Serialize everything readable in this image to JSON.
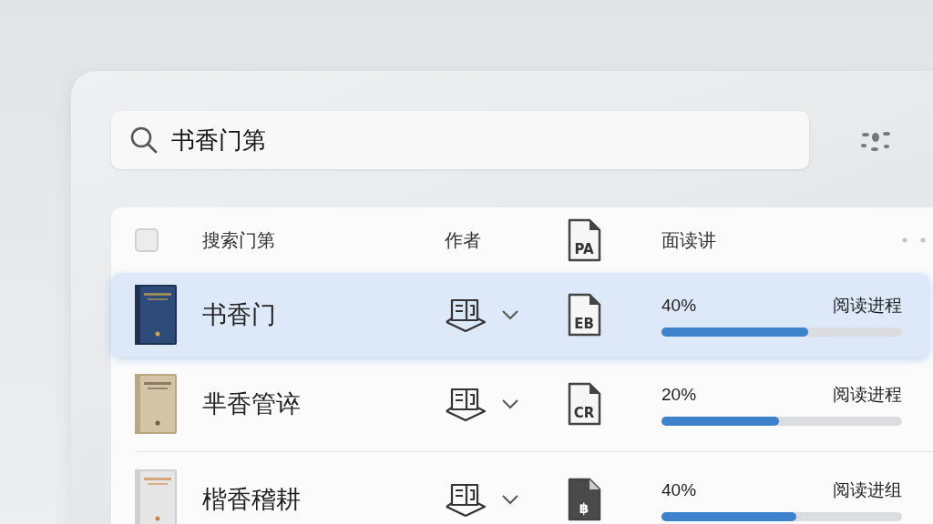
{
  "search": {
    "value": "书香门第"
  },
  "table": {
    "header": {
      "checked": false,
      "columns": [
        "搜索门第",
        "作者"
      ],
      "file_label": "PA",
      "progress_heading": "面读讲"
    },
    "rows": [
      {
        "title": "书香门",
        "file": {
          "label": "EB",
          "kind": "outline"
        },
        "percent": "40%",
        "level": 0.61,
        "status": "阅读进程",
        "selected": true
      },
      {
        "title": "芈香管谇",
        "file": {
          "label": "CR",
          "kind": "outline"
        },
        "percent": "20%",
        "level": 0.49,
        "status": "阅读进程",
        "selected": false
      },
      {
        "title": "楷香稽耕",
        "file": {
          "label": "฿",
          "kind": "filled"
        },
        "percent": "40%",
        "level": 0.56,
        "status": "阅读进组",
        "selected": false
      }
    ]
  }
}
